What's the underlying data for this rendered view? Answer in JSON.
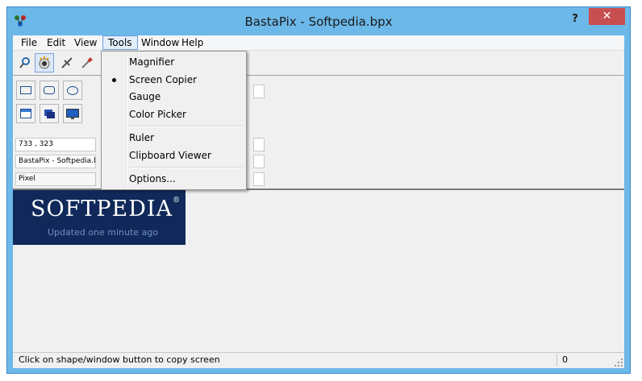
{
  "window": {
    "title": "BastaPix - Softpedia.bpx",
    "help_label": "?",
    "close_label": "✕"
  },
  "menubar": {
    "items": [
      "File",
      "Edit",
      "View",
      "Tools",
      "Window",
      "Help"
    ],
    "active": "Tools"
  },
  "toolbar": {
    "buttons": [
      "magnifier-icon",
      "screen-copier-icon",
      "gauge-icon",
      "color-picker-icon"
    ]
  },
  "panel": {
    "shape_buttons": [
      "rectangle-icon",
      "rounded-rectangle-icon",
      "ellipse-icon"
    ],
    "window_buttons": [
      "window-icon",
      "window-blue-icon",
      "desktop-icon"
    ],
    "coordinates": "733 , 323",
    "document_name": "BastaPix - Softpedia.bpx",
    "unit": "Pixel"
  },
  "tools_menu": {
    "items": [
      "Magnifier",
      "Screen Copier",
      "Gauge",
      "Color Picker",
      "Ruler",
      "Clipboard Viewer",
      "Options..."
    ],
    "checked": "Screen Copier"
  },
  "logo": {
    "title": "SOFTPEDIA",
    "registered": "®",
    "subtitle": "Updated one minute ago"
  },
  "statusbar": {
    "message": "Click on shape/window button to copy screen",
    "count": "0"
  },
  "colors": {
    "frame": "#6cb8e8",
    "close": "#c74f50",
    "logo_bg": "#10295a"
  }
}
